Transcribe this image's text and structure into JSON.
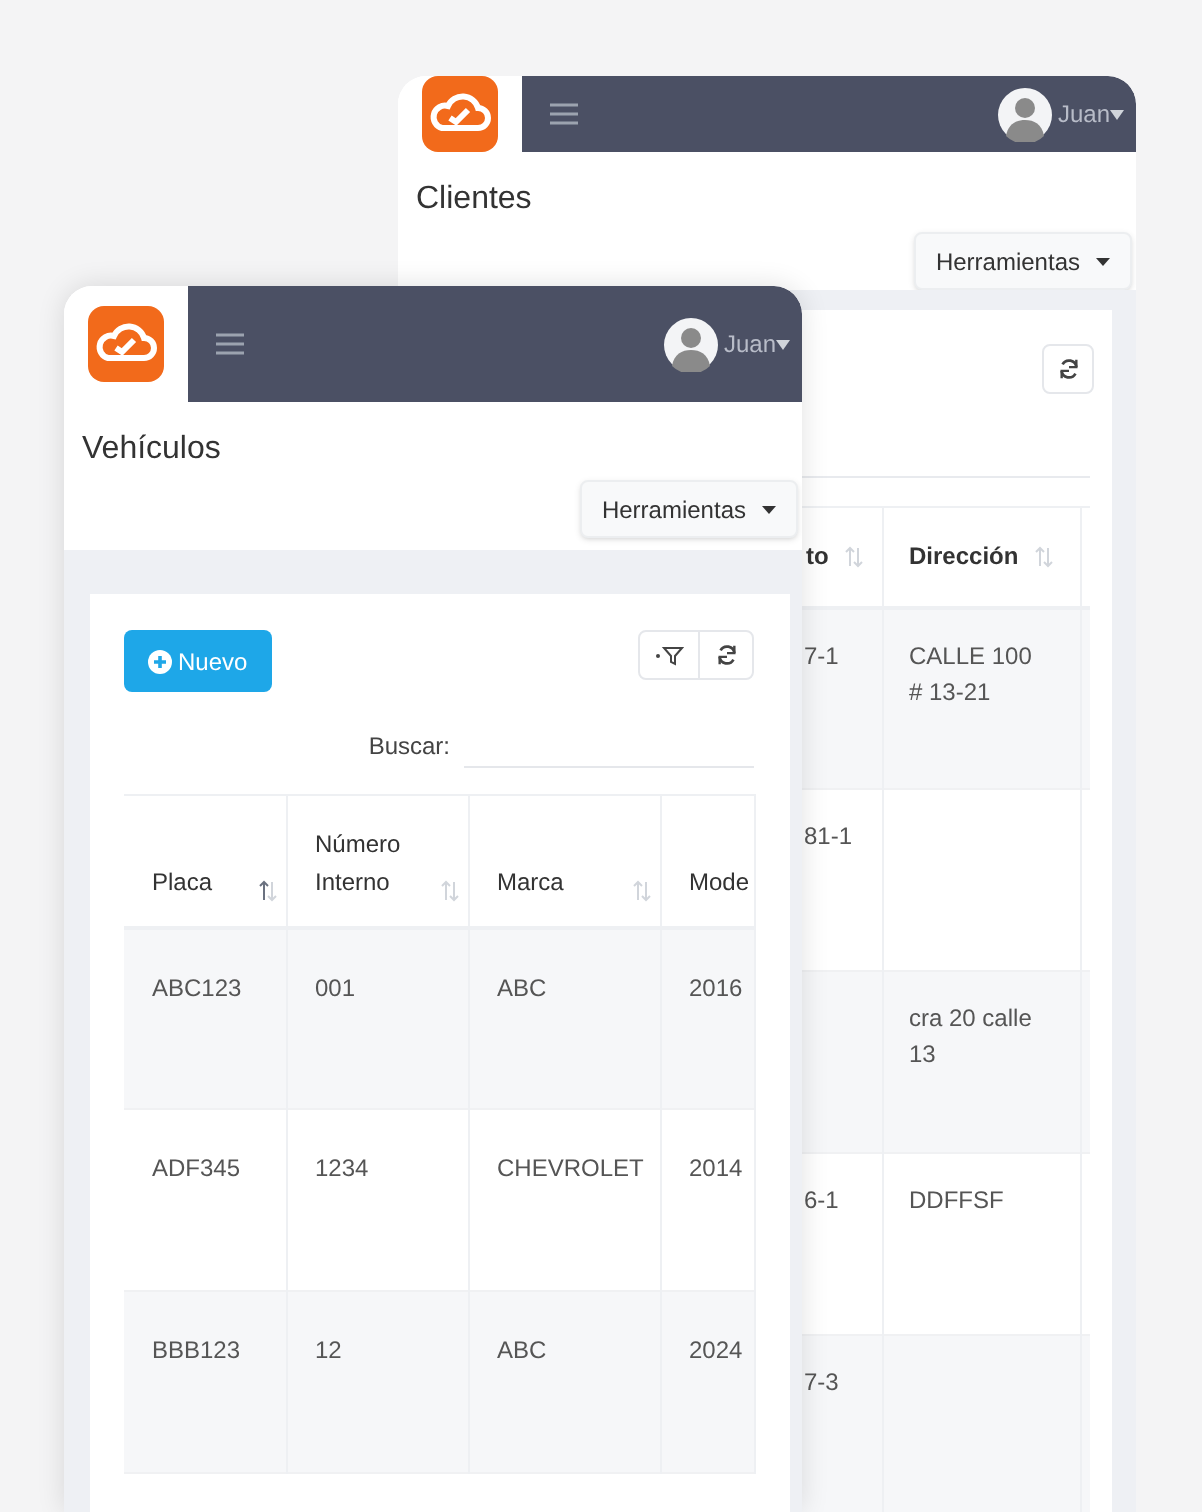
{
  "back_window": {
    "user": "Juan",
    "title": "Clientes",
    "tools_button": "Herramientas",
    "table": {
      "columns": [
        {
          "label": "to",
          "sorted": false
        },
        {
          "label": "Dirección",
          "sorted": false
        }
      ],
      "rows": [
        [
          "7-1",
          "CALLE 100 # 13-21"
        ],
        [
          "81-1",
          ""
        ],
        [
          "",
          "cra 20 calle 13"
        ],
        [
          "6-1",
          "DDFFSF"
        ],
        [
          "7-3",
          ""
        ]
      ]
    }
  },
  "front_window": {
    "user": "Juan",
    "title": "Vehículos",
    "tools_button": "Herramientas",
    "new_button": "Nuevo",
    "search_label": "Buscar:",
    "table": {
      "columns": [
        {
          "label": "Placa",
          "sorted": true
        },
        {
          "label": "Número Interno",
          "sorted": false
        },
        {
          "label": "Marca",
          "sorted": false
        },
        {
          "label": "Mode"
        }
      ],
      "rows": [
        [
          "ABC123",
          "001",
          "ABC",
          "2016"
        ],
        [
          "ADF345",
          "1234",
          "CHEVROLET",
          "2014"
        ],
        [
          "BBB123",
          "12",
          "ABC",
          "2024"
        ]
      ]
    }
  }
}
